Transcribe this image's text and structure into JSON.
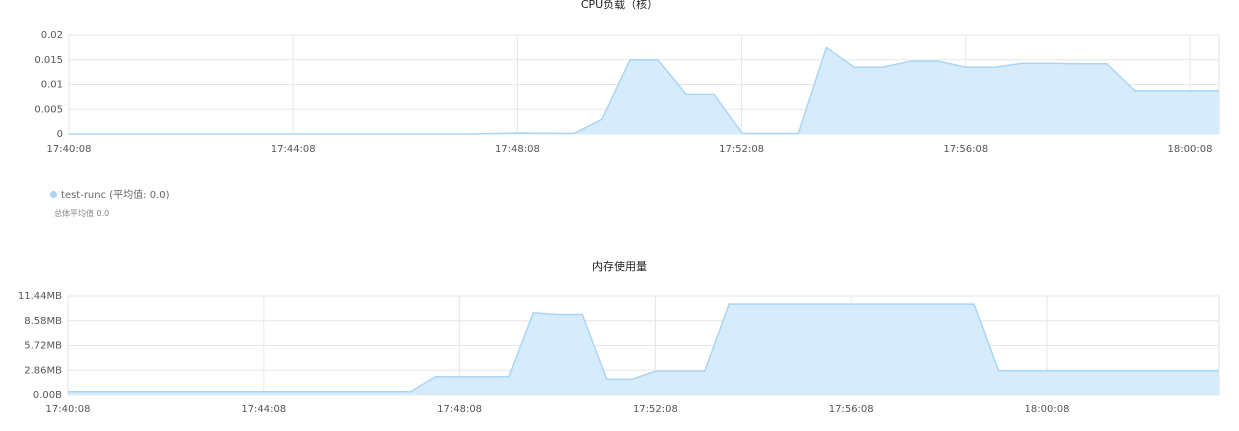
{
  "chart_data": [
    {
      "type": "area",
      "title": "CPU负载（核）",
      "xlabel": "",
      "ylabel": "",
      "x_tick_labels": [
        "17:40:08",
        "17:44:08",
        "17:48:08",
        "17:52:08",
        "17:56:08",
        "18:00:08"
      ],
      "y_tick_labels": [
        "0",
        "0.005",
        "0.01",
        "0.015",
        "0.02"
      ],
      "ylim": [
        0,
        0.02
      ],
      "xlim_minutes": [
        0,
        20.5
      ],
      "grid": true,
      "color": "#a9d6f5",
      "fill": "#d6ebfb",
      "legend": "bottom-left",
      "legend_label": "test-runc (平均值: 0.0)",
      "avg_note": "总体平均值 0.0",
      "series": [
        {
          "name": "test-runc",
          "x": [
            0,
            7.2,
            8.0,
            9.0,
            9.5,
            10.0,
            10.5,
            11.0,
            11.5,
            12.0,
            13.0,
            13.5,
            14.0,
            14.5,
            15.0,
            15.5,
            16.0,
            16.5,
            17.0,
            17.5,
            18.0,
            18.5,
            19.0,
            20.5
          ],
          "y": [
            0,
            0,
            0.0002,
            0.0001,
            0.003,
            0.015,
            0.015,
            0.008,
            0.008,
            0.0001,
            0.0001,
            0.0175,
            0.0135,
            0.0135,
            0.0147,
            0.0147,
            0.0135,
            0.0135,
            0.0143,
            0.0143,
            0.0142,
            0.0142,
            0.0087,
            0.0087
          ]
        }
      ]
    },
    {
      "type": "area",
      "title": "内存使用量",
      "xlabel": "",
      "ylabel": "",
      "x_tick_labels": [
        "17:40:08",
        "17:44:08",
        "17:48:08",
        "17:52:08",
        "17:56:08",
        "18:00:08"
      ],
      "y_tick_labels": [
        "0.00B",
        "2.86MB",
        "5.72MB",
        "8.58MB",
        "11.44MB"
      ],
      "ylim": [
        0,
        11.44
      ],
      "xlim_minutes": [
        0,
        23.5
      ],
      "grid": true,
      "color": "#a9d6f5",
      "fill": "#d6ebfb",
      "series": [
        {
          "name": "",
          "x": [
            0,
            7.0,
            7.5,
            9.0,
            9.5,
            10.0,
            10.5,
            11.0,
            11.5,
            12.0,
            13.0,
            13.5,
            14.0,
            18.5,
            19.0,
            23.5
          ],
          "y": [
            0.38,
            0.38,
            2.1,
            2.1,
            9.5,
            9.3,
            9.3,
            1.8,
            1.8,
            2.75,
            2.75,
            10.5,
            10.5,
            10.5,
            2.8,
            2.8
          ]
        }
      ]
    }
  ]
}
